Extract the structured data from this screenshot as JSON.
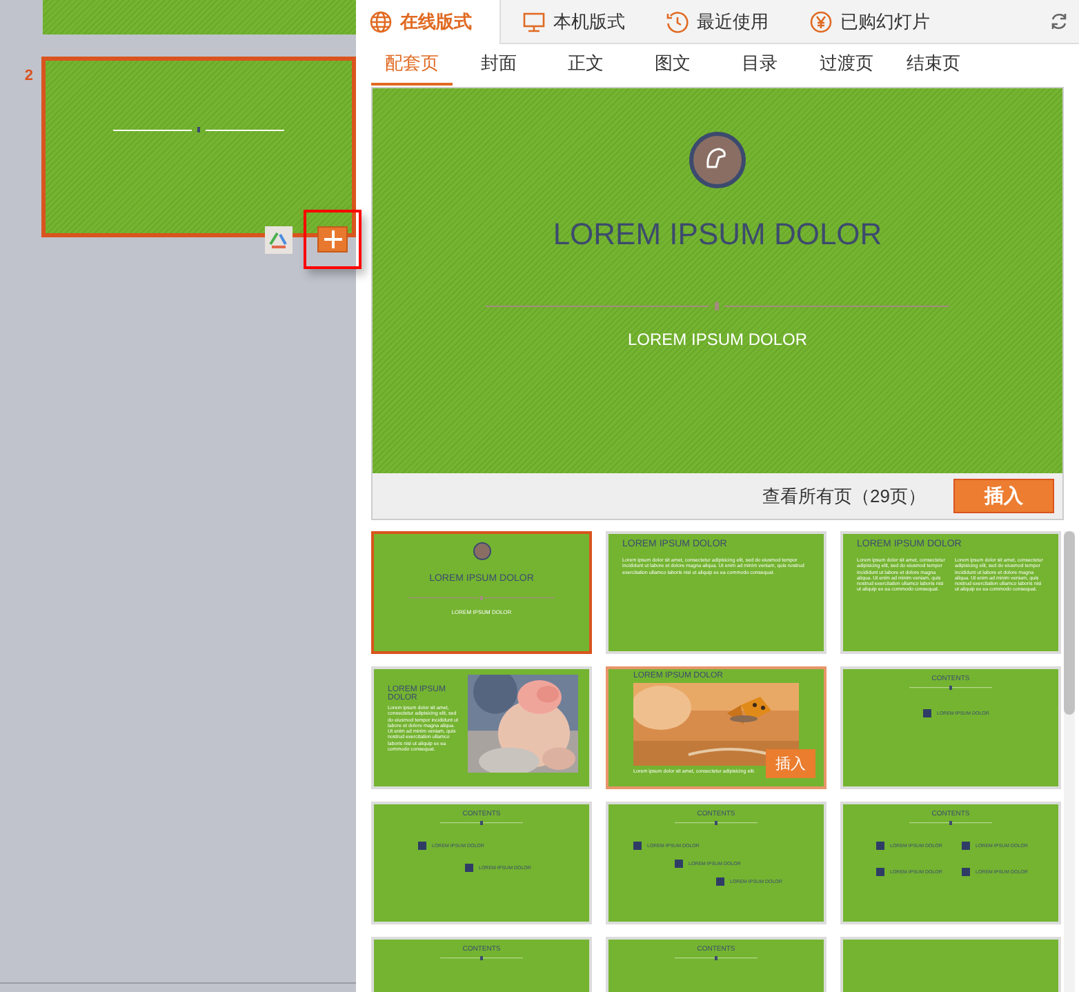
{
  "slides": [
    {
      "selected": false
    },
    {
      "number": "2",
      "selected": true
    }
  ],
  "tabs": [
    {
      "label": "在线版式",
      "selected": true
    },
    {
      "label": "本机版式",
      "selected": false
    },
    {
      "label": "最近使用",
      "selected": false
    },
    {
      "label": "已购幻灯片",
      "selected": false
    }
  ],
  "subtabs": [
    {
      "label": "配套页",
      "selected": true
    },
    {
      "label": "封面",
      "selected": false
    },
    {
      "label": "正文",
      "selected": false
    },
    {
      "label": "图文",
      "selected": false
    },
    {
      "label": "目录",
      "selected": false
    },
    {
      "label": "过渡页",
      "selected": false
    },
    {
      "label": "结束页",
      "selected": false
    }
  ],
  "preview": {
    "title": "LOREM IPSUM DOLOR",
    "subtitle": "LOREM IPSUM DOLOR",
    "page_count": "查看所有页（29页）",
    "insert_button": "插入"
  },
  "templates": [
    {
      "kind": "title",
      "selected": true,
      "hovered": false,
      "title": "LOREM IPSUM DOLOR",
      "subtitle": "LOREM IPSUM DOLOR"
    },
    {
      "kind": "text",
      "selected": false,
      "hovered": false,
      "title": "LOREM IPSUM DOLOR",
      "body": "Lorem ipsum dolor sit amet, consectetur adipisicing elit, sed do eiusmod tempor incididunt ut labore et dolore magna aliqua. Ut enim ad minim veniam, quis nostrud exercitation ullamco laboris nisi ut aliquip ex ea commodo consequat."
    },
    {
      "kind": "two_column",
      "selected": false,
      "hovered": false,
      "title": "LOREM IPSUM DOLOR",
      "columns": [
        "Lorem ipsum dolor sit amet, consectetur adipisicing elit, sed do eiusmod tempor incididunt ut labore et dolore magna aliqua. Ut enim ad minim veniam, quis nostrud exercitation ullamco laboris nisi ut aliquip ex ea commodo consequat.",
        "Lorem ipsum dolor sit amet, consectetur adipisicing elit, sed do eiusmod tempor incididunt ut labore et dolore magna aliqua. Ut enim ad minim veniam, quis nostrud exercitation ullamco laboris nisi ut aliquip ex ea commodo consequat."
      ]
    },
    {
      "kind": "picture_left",
      "selected": false,
      "hovered": false,
      "title": "LOREM IPSUM DOLOR",
      "body": "Lorem ipsum dolor sit amet, consectetur adipisicing elit, sed do eiusmod tempor incididunt ut labore et dolore magna aliqua. Ut enim ad minim veniam, quis nostrud exercitation ullamco laboris nisi ut aliquip ex ea commodo consequat."
    },
    {
      "kind": "picture",
      "selected": false,
      "hovered": true,
      "title": "LOREM IPSUM DOLOR",
      "caption": "Lorem ipsum dolor sit amet, consectetur adipisicing elit.",
      "insert_button": "插入"
    },
    {
      "kind": "contents",
      "selected": false,
      "hovered": false,
      "title": "CONTENTS",
      "items": [
        "LOREM IPSUM DOLOR"
      ]
    },
    {
      "kind": "contents",
      "selected": false,
      "hovered": false,
      "title": "CONTENTS",
      "items": [
        "LOREM IPSUM DOLOR",
        "LOREM IPSUM DOLOR"
      ]
    },
    {
      "kind": "contents",
      "selected": false,
      "hovered": false,
      "title": "CONTENTS",
      "items": [
        "LOREM IPSUM DOLOR",
        "LOREM IPSUM DOLOR",
        "LOREM IPSUM DOLOR"
      ]
    },
    {
      "kind": "contents",
      "selected": false,
      "hovered": false,
      "title": "CONTENTS",
      "items": [
        "LOREM IPSUM DOLOR",
        "LOREM IPSUM DOLOR",
        "LOREM IPSUM DOLOR",
        "LOREM IPSUM DOLOR"
      ]
    },
    {
      "kind": "contents",
      "selected": false,
      "hovered": false,
      "title": "CONTENTS"
    },
    {
      "kind": "contents",
      "selected": false,
      "hovered": false,
      "title": "CONTENTS"
    },
    {
      "kind": "blank",
      "selected": false,
      "hovered": false
    }
  ]
}
